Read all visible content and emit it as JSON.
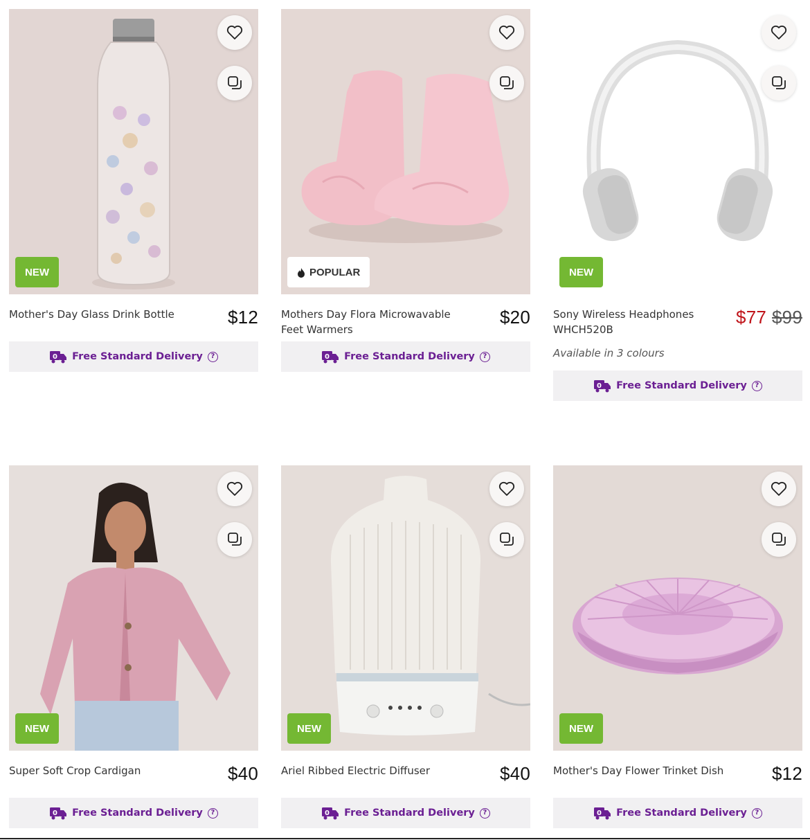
{
  "products": [
    {
      "title": "Mother's Day Glass Drink Bottle",
      "price": "$12",
      "badge": "NEW",
      "delivery": "Free Standard Delivery"
    },
    {
      "title": "Mothers Day Flora Microwavable Feet Warmers",
      "price": "$20",
      "badge": "POPULAR",
      "delivery": "Free Standard Delivery"
    },
    {
      "title": "Sony Wireless Headphones WHCH520B",
      "price_sale": "$77",
      "price_was": "$99",
      "badge": "NEW",
      "colours": "Available in 3 colours",
      "delivery": "Free Standard Delivery"
    },
    {
      "title": "Super Soft Crop Cardigan",
      "price": "$40",
      "badge": "NEW",
      "delivery": "Free Standard Delivery"
    },
    {
      "title": "Ariel Ribbed Electric Diffuser",
      "price": "$40",
      "badge": "NEW",
      "delivery": "Free Standard Delivery"
    },
    {
      "title": "Mother's Day Flower Trinket Dish",
      "price": "$12",
      "badge": "NEW",
      "delivery": "Free Standard Delivery"
    }
  ],
  "icons": {
    "wishlist": "heart-icon",
    "compare": "compare-icon",
    "delivery": "delivery-truck-icon",
    "help": "help-icon",
    "popular": "flame-icon"
  },
  "colors": {
    "new_badge": "#74b833",
    "delivery_text": "#6b1f93",
    "sale_price": "#c0141a"
  }
}
